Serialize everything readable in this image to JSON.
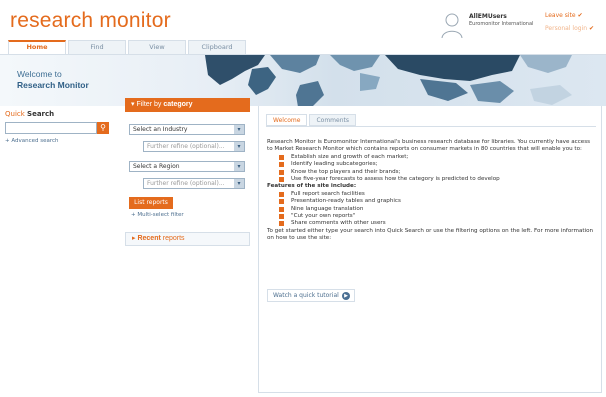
{
  "brand": {
    "logo": "research monitor",
    "accent_color": "#e46b1d"
  },
  "user": {
    "name": "AllEMUsers",
    "org": "Euromonitor International",
    "links": [
      "Leave site",
      "Personal login"
    ]
  },
  "nav": {
    "tabs": [
      "Home",
      "Find",
      "View",
      "Clipboard"
    ],
    "active_tab": "Home"
  },
  "banner": {
    "welcome_to": "Welcome to",
    "product": "Research Monitor"
  },
  "quick_search": {
    "label_a": "Quick",
    "label_b": "Search",
    "placeholder": "",
    "advanced_link": "+ Advanced search"
  },
  "filter": {
    "title_a": "Filter by",
    "title_b": "category",
    "industry": "Select an Industry",
    "industry_refine": "Further refine (optional)...",
    "region": "Select a Region",
    "region_refine": "Further refine (optional)...",
    "list_button": "List reports",
    "multi_link": "+ Multi-select filter"
  },
  "recent": {
    "label_a": "Recent",
    "label_b": "reports"
  },
  "main": {
    "tabs": [
      "Welcome",
      "Comments"
    ],
    "active_tab": "Welcome",
    "intro": "Research Monitor is Euromonitor International's business research database for libraries. You currently have access to Market Research Monitor which contains reports on consumer markets in 80 countries that will enable you to:",
    "benefits": [
      "Establish size and growth of each market;",
      "Identify leading subcategories;",
      "Know the top players and their brands;",
      "Use five-year forecasts to assess how the category is predicted to develop"
    ],
    "features_title": "Features of the site include:",
    "features": [
      "Full report search facilities",
      "Presentation-ready tables and graphics",
      "Nine language translation",
      "\"Cut your own reports\"",
      "Share comments with other users"
    ],
    "outro": "To get started either type your search into Quick Search or use the filtering options on the left. For more information on how to use the site:",
    "tutorial_button": "Watch a quick tutorial"
  }
}
